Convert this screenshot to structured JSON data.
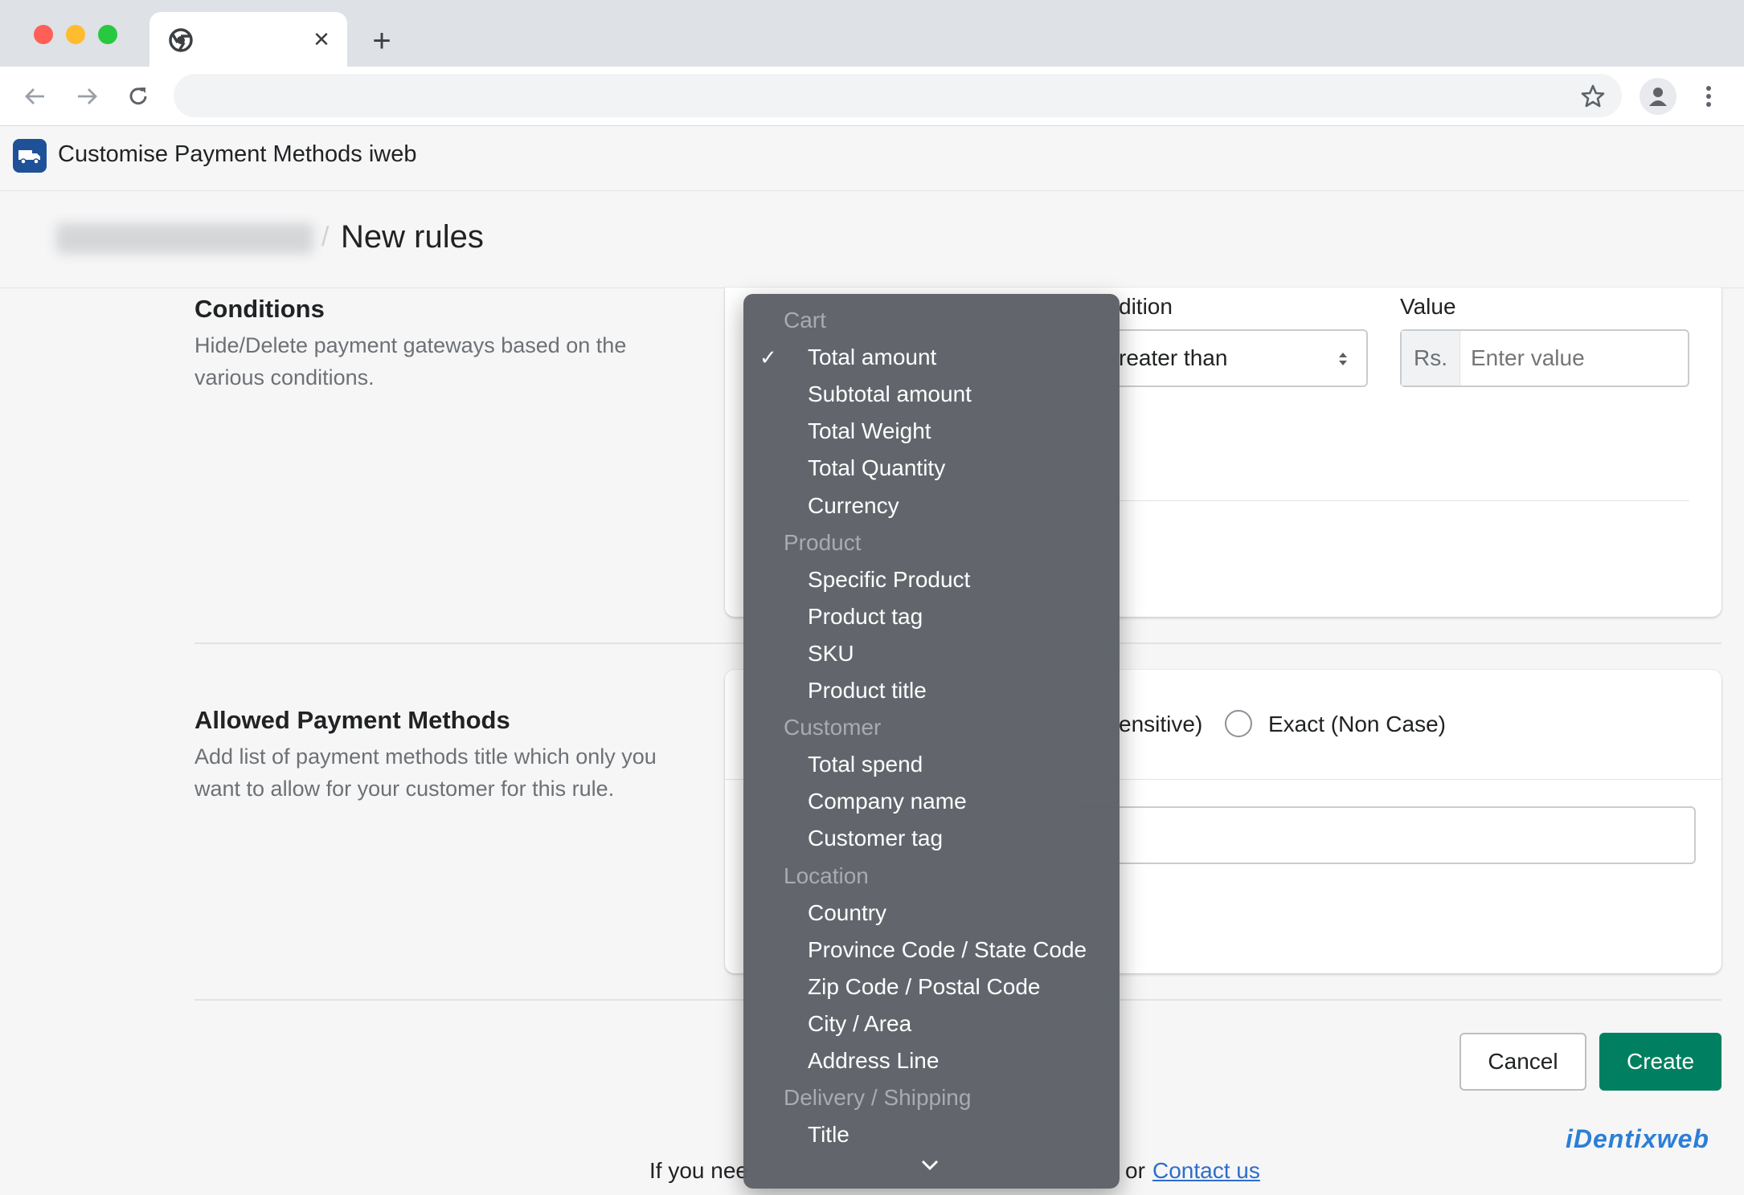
{
  "browser": {
    "tab_close": "✕",
    "new_tab": "+"
  },
  "app": {
    "title": "Customise Payment Methods iweb"
  },
  "page": {
    "breadcrumb_separator": "/",
    "title": "New rules"
  },
  "conditions": {
    "title": "Conditions",
    "description": "Hide/Delete payment gateways based on the various conditions.",
    "condition_label_partial": "dition",
    "condition_value_partial": "reater than",
    "value_label": "Value",
    "value_prefix": "Rs.",
    "value_placeholder": "Enter value"
  },
  "allowed_methods": {
    "title": "Allowed Payment Methods",
    "description": "Add list of payment methods title which only you want to allow for your customer for this rule.",
    "radio_partial_label": "ensitive)",
    "radio_exact_label": "Exact (Non Case)"
  },
  "actions": {
    "cancel": "Cancel",
    "create": "Create"
  },
  "footer": {
    "text_left": "If you nee",
    "text_right": "or",
    "contact_link": "Contact us"
  },
  "branding": {
    "logo_text": "iDentixweb"
  },
  "dropdown": {
    "selected": "Total amount",
    "rows": [
      {
        "type": "group",
        "label": "Cart"
      },
      {
        "type": "item",
        "label": "Total amount",
        "checked": true
      },
      {
        "type": "item",
        "label": "Subtotal amount"
      },
      {
        "type": "item",
        "label": "Total Weight"
      },
      {
        "type": "item",
        "label": "Total Quantity"
      },
      {
        "type": "item",
        "label": "Currency"
      },
      {
        "type": "group",
        "label": "Product"
      },
      {
        "type": "item",
        "label": "Specific Product"
      },
      {
        "type": "item",
        "label": "Product tag"
      },
      {
        "type": "item",
        "label": "SKU"
      },
      {
        "type": "item",
        "label": "Product title"
      },
      {
        "type": "group",
        "label": "Customer"
      },
      {
        "type": "item",
        "label": "Total spend"
      },
      {
        "type": "item",
        "label": "Company name"
      },
      {
        "type": "item",
        "label": "Customer tag"
      },
      {
        "type": "group",
        "label": "Location"
      },
      {
        "type": "item",
        "label": "Country"
      },
      {
        "type": "item",
        "label": "Province Code / State Code"
      },
      {
        "type": "item",
        "label": "Zip Code / Postal Code"
      },
      {
        "type": "item",
        "label": "City / Area"
      },
      {
        "type": "item",
        "label": "Address Line"
      },
      {
        "type": "group",
        "label": "Delivery / Shipping"
      },
      {
        "type": "item",
        "label": "Title"
      }
    ]
  },
  "colors": {
    "primary_button": "#008060",
    "link": "#2c6ecb",
    "app_icon": "#1f5199"
  }
}
